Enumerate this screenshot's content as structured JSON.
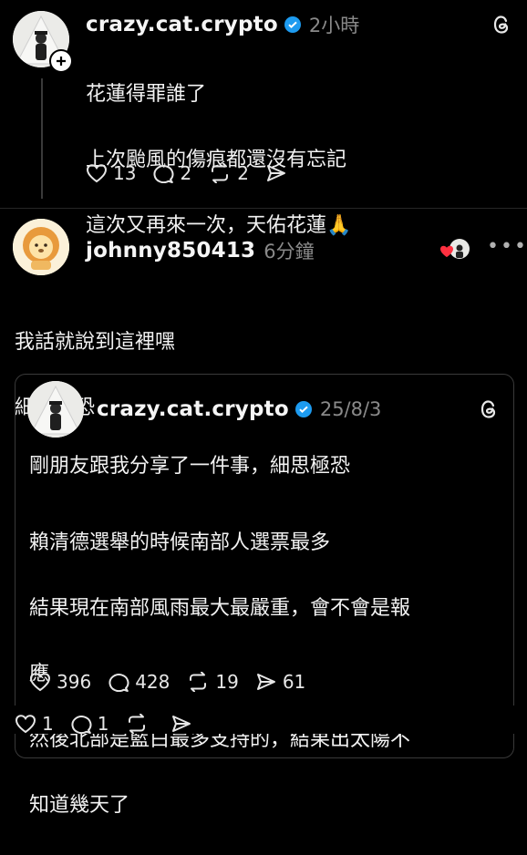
{
  "post1": {
    "username": "crazy.cat.crypto",
    "time": "2小時",
    "lines": [
      "花蓮得罪誰了",
      "上次颱風的傷痕都還沒有忘記",
      "這次又再來一次，天佑花蓮"
    ],
    "emoji": "🙏",
    "likes": "13",
    "comments": "2",
    "reposts": "2"
  },
  "post2": {
    "username": "johnny850413",
    "time": "6分鐘",
    "lines": [
      "我話就說到這裡嘿",
      "細思極恐"
    ],
    "likes": "1",
    "comments": "1"
  },
  "quoted": {
    "username": "crazy.cat.crypto",
    "time": "25/8/3",
    "para1": "剛朋友跟我分享了一件事，細思極恐",
    "para2_lines": [
      "賴清德選舉的時候南部人選票最多",
      "結果現在南部風雨最大最嚴重，會不會是報",
      "應",
      "然後北部是藍白最多支持的，結果出太陽不",
      "知道幾天了"
    ],
    "likes": "396",
    "comments": "428",
    "reposts": "19",
    "shares": "61"
  },
  "colors": {
    "verified": "#1d9bf0",
    "heart": "#ff3040",
    "background": "#000000"
  },
  "icons": [
    "threads-icon",
    "heart-icon",
    "comment-icon",
    "repost-icon",
    "share-icon",
    "verified-icon",
    "more-icon",
    "plus-icon"
  ]
}
